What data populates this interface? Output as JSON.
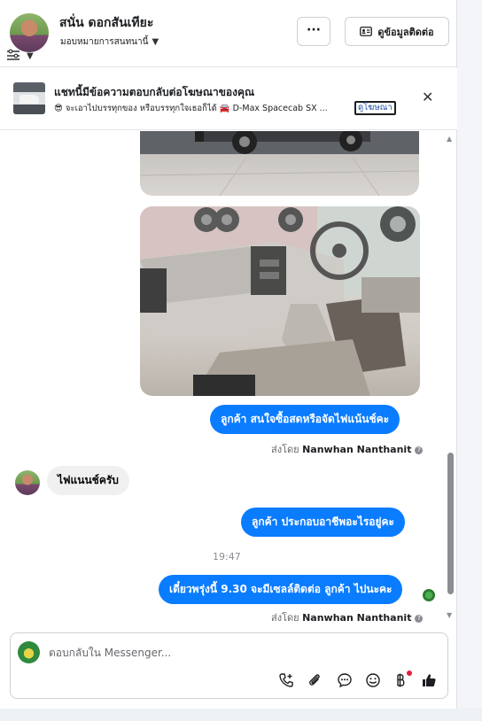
{
  "header": {
    "contact_name": "สนั่น ดอกสันเทียะ",
    "assign_label": "มอบหมายการสนทนานี้",
    "more_label": "···",
    "info_button_label": "ดูข้อมูลติดต่อ"
  },
  "ad_banner": {
    "title": "แชทนี้มีข้อความตอบกลับต่อโฆษณาของคุณ",
    "description": "😎 จะเอาไปบรรทุกของ หรือบรรทุกใจเธอก็ได้ 🚘 D-Max Spacecab SX ...",
    "link_label": "ดูโฆษณา",
    "close_label": "✕"
  },
  "messages": [
    {
      "direction": "outgoing",
      "text": "ลูกค้า สนใจซื้อสดหรือจัดไฟแน้นช์คะ"
    },
    {
      "direction": "incoming",
      "text": "ไฟแนนช์ครับ"
    },
    {
      "direction": "outgoing",
      "text": "ลูกค้า ประกอบอาชีพอะไรอยู่คะ"
    },
    {
      "direction": "outgoing",
      "text": "เดี๋ยวพรุ่งนี้ 9.30 จะมีเซลล์ติดต่อ ลูกค้า ไปนะคะ"
    }
  ],
  "sent_by": {
    "prefix": "ส่งโดย",
    "name": "Nanwhan Nanthanit",
    "info_glyph": "?"
  },
  "timestamp": "19:47",
  "composer": {
    "placeholder": "ตอบกลับใน Messenger..."
  },
  "icons": {
    "scroll_up": "▲",
    "scroll_down": "▼",
    "caret": "▼"
  },
  "colors": {
    "outgoing_bubble": "#0a7cff",
    "incoming_bubble": "#f0f0f0"
  }
}
